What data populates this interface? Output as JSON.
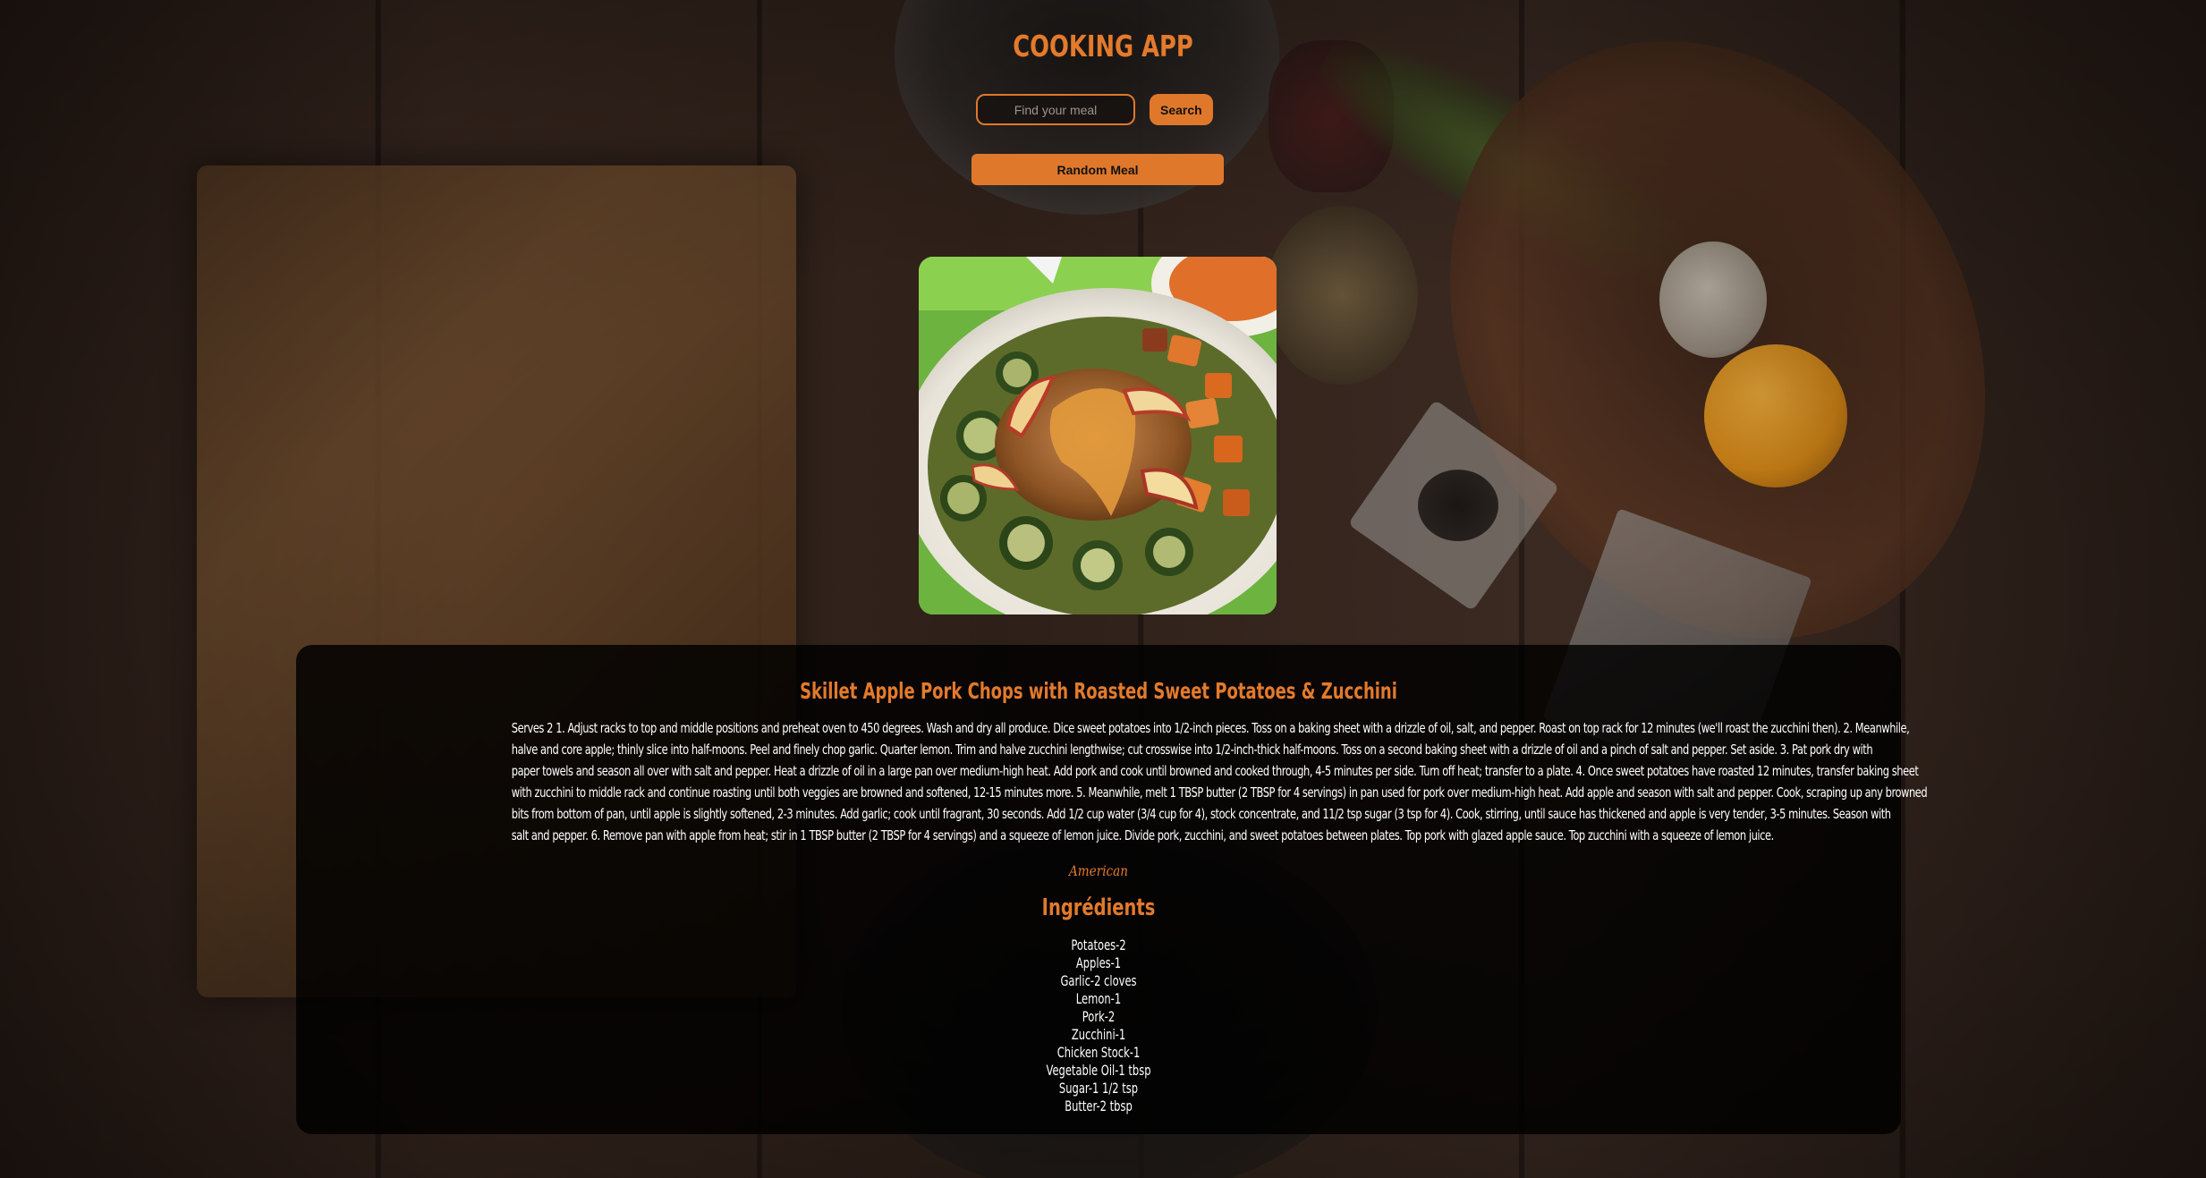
{
  "app": {
    "title": "COOKING APP"
  },
  "search": {
    "placeholder": "Find your meal",
    "value": "",
    "button_label": "Search"
  },
  "random_button_label": "Random Meal",
  "meal": {
    "image_alt": "Skillet Apple Pork Chops with Roasted Sweet Potatoes & Zucchini",
    "name": "Skillet Apple Pork Chops with Roasted Sweet Potatoes & Zucchini",
    "instruction_lines": [
      "Serves 2 1. Adjust racks to top and middle positions and preheat oven to 450 degrees. Wash and dry all produce. Dice sweet potatoes into 1/2-inch pieces. Toss on a baking sheet with a drizzle of oil, salt, and pepper. Roast on top rack for 12 minutes (we'll roast the zucchini then). 2. Meanwhile,",
      "halve and core apple; thinly slice into half-moons. Peel and finely chop garlic. Quarter lemon. Trim and halve zucchini lengthwise; cut crosswise into 1/2-inch-thick half-moons. Toss on a second baking sheet with a drizzle of oil and a pinch of salt and pepper. Set aside. 3. Pat pork dry with",
      "paper towels and season all over with salt and pepper. Heat a drizzle of oil in a large pan over medium-high heat. Add pork and cook until browned and cooked through, 4-5 minutes per side. Turn off heat; transfer to a plate. 4. Once sweet potatoes have roasted 12 minutes, transfer baking sheet",
      "with zucchini to middle rack and continue roasting until both veggies are browned and softened, 12-15 minutes more. 5. Meanwhile, melt 1 TBSP butter (2 TBSP for 4 servings) in pan used for pork over medium-high heat. Add apple and season with salt and pepper. Cook, scraping up any browned",
      "bits from bottom of pan, until apple is slightly softened, 2-3 minutes. Add garlic; cook until fragrant, 30 seconds. Add 1/2 cup water (3/4 cup for 4), stock concentrate, and 11/2 tsp sugar (3 tsp for 4). Cook, stirring, until sauce has thickened and apple is very tender, 3-5 minutes. Season with",
      "salt and pepper. 6. Remove pan with apple from heat; stir in 1 TBSP butter (2 TBSP for 4 servings) and a squeeze of lemon juice. Divide pork, zucchini, and sweet potatoes between plates. Top pork with glazed apple sauce. Top zucchini with a squeeze of lemon juice."
    ],
    "area": "American",
    "ingredients_title": "Ingrédients",
    "ingredients": [
      "Potatoes-2",
      "Apples-1",
      "Garlic-2 cloves",
      "Lemon-1",
      "Pork-2",
      "Zucchini-1",
      "Chicken Stock-1",
      "Vegetable Oil-1 tbsp",
      "Sugar-1 1/2 tsp",
      "Butter-2 tbsp"
    ]
  },
  "colors": {
    "accent": "#e0782b",
    "card_background": "rgba(0,0,0,0.83)",
    "text": "#ffffff"
  },
  "icons": {
    "meal_photo": "food-photo"
  }
}
